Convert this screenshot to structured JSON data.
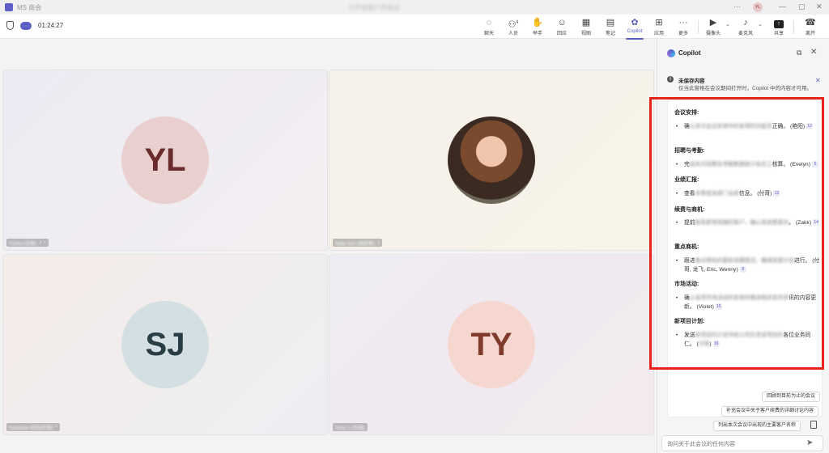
{
  "window": {
    "app_title": "MS 商会",
    "center_title": "与外部客户的会议",
    "user_initials": "YL",
    "controls": [
      "—",
      "▢",
      "✕"
    ]
  },
  "toolbar": {
    "timer": "01:24:27",
    "people_count": "4",
    "tools": [
      {
        "key": "chat",
        "label": "聊天",
        "icon": "chat-icon",
        "glyph": "◌"
      },
      {
        "key": "people",
        "label": "人员",
        "icon": "people-icon",
        "glyph": "⚇"
      },
      {
        "key": "raise",
        "label": "举手",
        "icon": "raise-hand-icon",
        "glyph": "✋"
      },
      {
        "key": "react",
        "label": "回应",
        "icon": "reaction-icon",
        "glyph": "☺"
      },
      {
        "key": "view",
        "label": "视图",
        "icon": "view-icon",
        "glyph": "▦"
      },
      {
        "key": "notes",
        "label": "笔记",
        "icon": "notes-icon",
        "glyph": "▤"
      },
      {
        "key": "copilot",
        "label": "Copilot",
        "icon": "copilot-icon",
        "glyph": "✿"
      },
      {
        "key": "apps",
        "label": "应用",
        "icon": "apps-icon",
        "glyph": "⊞"
      },
      {
        "key": "more",
        "label": "更多",
        "icon": "more-icon",
        "glyph": "···"
      },
      {
        "key": "camera",
        "label": "摄像头",
        "icon": "camera-icon",
        "glyph": "▶"
      },
      {
        "key": "mic",
        "label": "麦克风",
        "icon": "mic-off-icon",
        "glyph": "♪"
      },
      {
        "key": "share",
        "label": "共享",
        "icon": "share-icon",
        "glyph": "↑"
      },
      {
        "key": "leave",
        "label": "离开",
        "icon": "leave-icon",
        "glyph": "☎"
      }
    ]
  },
  "participants": [
    {
      "initials": "YL",
      "name": "Yuzhu (访客)"
    },
    {
      "initials": "",
      "name": "Sally Sun (组织者)"
    },
    {
      "initials": "SJ",
      "name": "Swimmer 机构(外部)"
    },
    {
      "initials": "TY",
      "name": "Tony Li (外部)"
    }
  ],
  "copilot": {
    "title": "Copilot",
    "notice_title": "未保存内容",
    "notice_body": "仅当此窗格在会议期间打开时，Copilot 中的内容才可用。",
    "sections": [
      {
        "title": "会议安排:",
        "items": [
          {
            "lead": "确",
            "blur": "认本次会议安排中的各项时间是否",
            "tail": "正确。 (艳阳)",
            "ref": "12"
          }
        ]
      },
      {
        "title": "招聘与考勤:",
        "items": [
          {
            "lead": "完",
            "blur": "成本月招聘及考勤数据统计和员工",
            "tail": "核算。 (Evelyn)",
            "ref": "5"
          }
        ]
      },
      {
        "title": "业绩汇报:",
        "items": [
          {
            "lead": "查看",
            "blur": "本季度各部门业绩",
            "tail": "信息。 (付哥)",
            "ref": "13"
          }
        ]
      },
      {
        "title": "续费与商机:",
        "items": [
          {
            "lead": "提前",
            "blur": "联系即将到期的客户，确认其续费意向",
            "tail": "。 (Zakk)",
            "ref": "14"
          }
        ]
      },
      {
        "title": "重点商机:",
        "items": [
          {
            "lead": "跟进",
            "blur": "重点商机的最新进展情况，确保其按计划",
            "tail": "进行。 (付哥, 龙飞, Eric, Wenny)",
            "ref": "8"
          }
        ]
      },
      {
        "title": "市场活动:",
        "items": [
          {
            "lead": "确",
            "blur": "认各项市场活动的安排并跟进相关宣传资",
            "tail": "讯的内容更新。 (Violet)",
            "ref": "15"
          }
        ]
      },
      {
        "title": "新项目计划:",
        "items": [
          {
            "lead": "发送",
            "blur": "新项目的计划书给公司负责该项目的",
            "tail": "各位业务同仁。 (",
            "blur2": "付哥",
            "tail2": ")",
            "ref": "16"
          }
        ]
      }
    ],
    "suggestions": [
      "回顾到目前为止的会议",
      "补充会议中关于客户续费的详细讨论内容",
      "列出本次会议中出现的主要客户名称"
    ],
    "prompt_placeholder": "询问关于此会议的任何内容"
  }
}
